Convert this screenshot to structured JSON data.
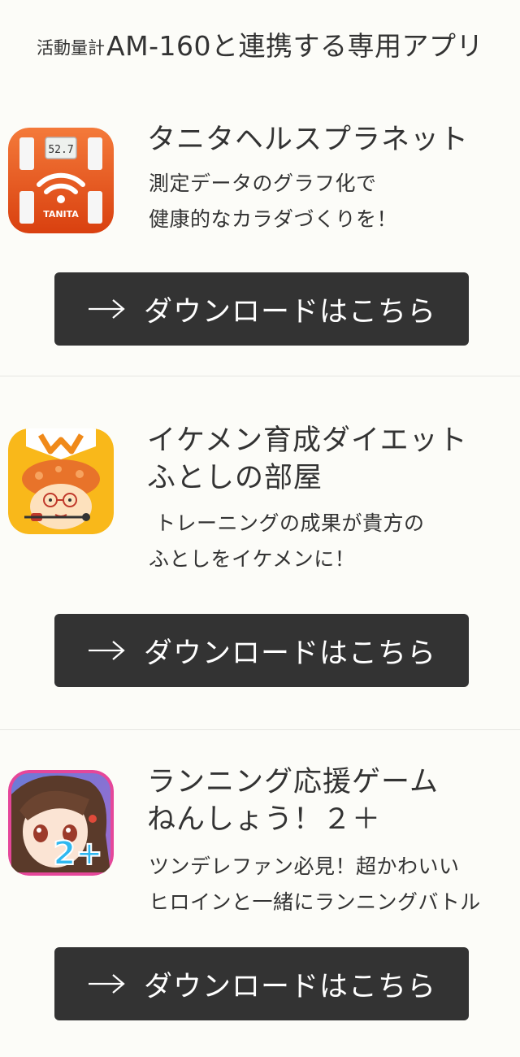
{
  "header": {
    "small": "活動量計",
    "big": "AM-160と連携する専用アプリ"
  },
  "apps": [
    {
      "title_lines": [
        "タニタヘルスプラネット"
      ],
      "desc_lines": [
        "測定データのグラフ化で",
        "健康的なカラダづくりを！"
      ],
      "icon": "tanita-scale-icon",
      "icon_text": {
        "display": "52.7",
        "brand": "TANITA"
      },
      "button_label": "ダウンロードはこちら"
    },
    {
      "title_lines": [
        "イケメン育成ダイエット",
        "ふとしの部屋"
      ],
      "desc_lines": [
        "トレーニングの成果が貴方の",
        "ふとしをイケメンに！"
      ],
      "icon": "futoshi-character-icon",
      "button_label": "ダウンロードはこちら"
    },
    {
      "title_lines": [
        "ランニング応援ゲーム",
        "ねんしょう！２＋"
      ],
      "desc_lines": [
        "ツンデレファン必見！超かわいい",
        "ヒロインと一緒にランニングバトル"
      ],
      "icon": "nensho-heroine-icon",
      "icon_text": {
        "badge": "2+"
      },
      "button_label": "ダウンロードはこちら"
    }
  ],
  "colors": {
    "background": "#fcfcf8",
    "button": "#333333",
    "tanita_orange": "#e8541c",
    "futoshi_yellow": "#f9b81a",
    "nensho_pink": "#e5479a"
  }
}
